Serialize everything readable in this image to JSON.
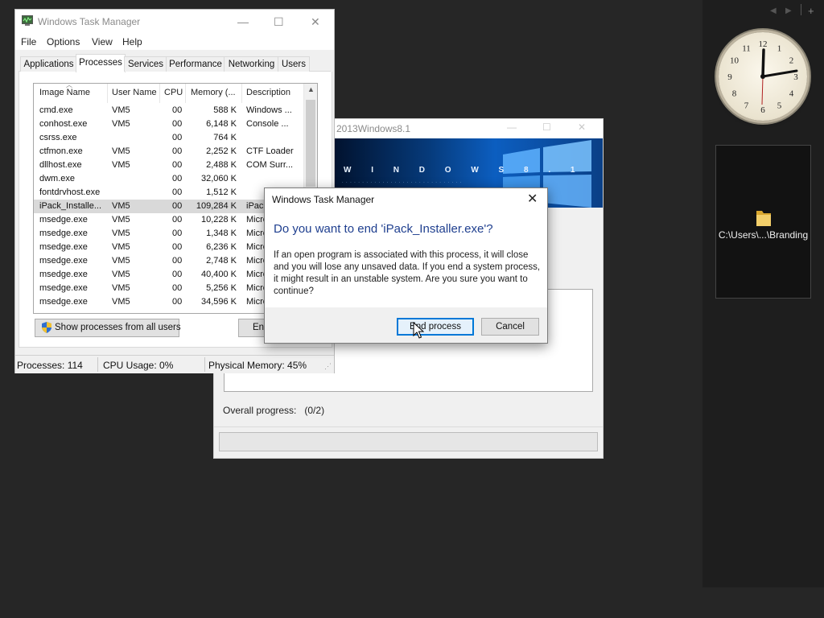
{
  "task_manager": {
    "title": "Windows Task Manager",
    "menu": [
      "File",
      "Options",
      "View",
      "Help"
    ],
    "tabs": [
      "Applications",
      "Processes",
      "Services",
      "Performance",
      "Networking",
      "Users"
    ],
    "active_tab": "Processes",
    "columns": [
      "Image Name",
      "User Name",
      "CPU",
      "Memory (...",
      "Description"
    ],
    "processes": [
      {
        "name": "cmd.exe",
        "user": "VM5",
        "cpu": "00",
        "mem": "588 K",
        "desc": "Windows ..."
      },
      {
        "name": "conhost.exe",
        "user": "VM5",
        "cpu": "00",
        "mem": "6,148 K",
        "desc": "Console ..."
      },
      {
        "name": "csrss.exe",
        "user": "",
        "cpu": "00",
        "mem": "764 K",
        "desc": ""
      },
      {
        "name": "ctfmon.exe",
        "user": "VM5",
        "cpu": "00",
        "mem": "2,252 K",
        "desc": "CTF Loader"
      },
      {
        "name": "dllhost.exe",
        "user": "VM5",
        "cpu": "00",
        "mem": "2,488 K",
        "desc": "COM Surr..."
      },
      {
        "name": "dwm.exe",
        "user": "",
        "cpu": "00",
        "mem": "32,060 K",
        "desc": ""
      },
      {
        "name": "fontdrvhost.exe",
        "user": "",
        "cpu": "00",
        "mem": "1,512 K",
        "desc": ""
      },
      {
        "name": "iPack_Installe...",
        "user": "VM5",
        "cpu": "00",
        "mem": "109,284 K",
        "desc": "iPack"
      },
      {
        "name": "msedge.exe",
        "user": "VM5",
        "cpu": "00",
        "mem": "10,228 K",
        "desc": "Micro"
      },
      {
        "name": "msedge.exe",
        "user": "VM5",
        "cpu": "00",
        "mem": "1,348 K",
        "desc": "Micro"
      },
      {
        "name": "msedge.exe",
        "user": "VM5",
        "cpu": "00",
        "mem": "6,236 K",
        "desc": "Micro"
      },
      {
        "name": "msedge.exe",
        "user": "VM5",
        "cpu": "00",
        "mem": "2,748 K",
        "desc": "Micro"
      },
      {
        "name": "msedge.exe",
        "user": "VM5",
        "cpu": "00",
        "mem": "40,400 K",
        "desc": "Micro"
      },
      {
        "name": "msedge.exe",
        "user": "VM5",
        "cpu": "00",
        "mem": "5,256 K",
        "desc": "Micro"
      },
      {
        "name": "msedge.exe",
        "user": "VM5",
        "cpu": "00",
        "mem": "34,596 K",
        "desc": "Micro"
      }
    ],
    "selected_process": "iPack_Installe...",
    "show_all_button": "Show processes from all users",
    "end_button_partial": "End",
    "status": {
      "processes": "Processes: 114",
      "cpu": "CPU Usage: 0%",
      "memory": "Physical Memory: 45%"
    }
  },
  "installer": {
    "title": "2013Windows8.1",
    "banner_text": "W I N D O W S  8 . 1",
    "progress_label": "Overall progress:",
    "progress_value": "(0/2)",
    "progress_fraction": 0
  },
  "dialog": {
    "title": "Windows Task Manager",
    "close_glyph": "✕",
    "heading": "Do you want to end 'iPack_Installer.exe'?",
    "message": "If an open program is associated with this process, it will close and you will lose any unsaved data. If you end a system process, it might result in an unstable system. Are you sure you want to continue?",
    "end_process_button": "End process",
    "cancel_button": "Cancel"
  },
  "desktop": {
    "gadget_controls": [
      "◀",
      "▶",
      "+"
    ],
    "folder_gadget_label": "C:\\Users\\...\\Branding",
    "clock_numbers": [
      "12",
      "1",
      "2",
      "3",
      "4",
      "5",
      "6",
      "7",
      "8",
      "9",
      "10",
      "11"
    ]
  },
  "colors": {
    "desktop_bg": "#262626",
    "dialog_heading": "#1f3f8f",
    "primary_button_border": "#0078d7"
  }
}
